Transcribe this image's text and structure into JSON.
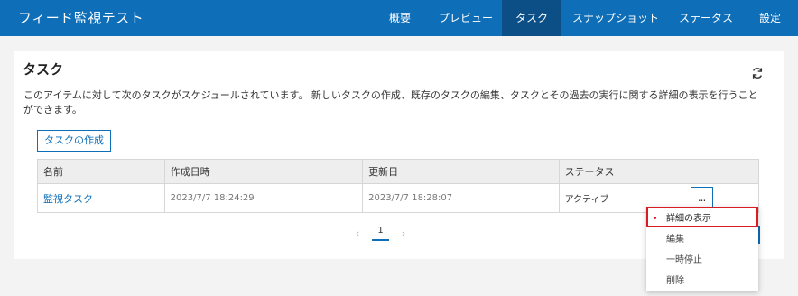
{
  "header": {
    "title": "フィード監視テスト",
    "nav": [
      {
        "label": "概要"
      },
      {
        "label": "プレビュー"
      },
      {
        "label": "タスク"
      },
      {
        "label": "スナップショット"
      },
      {
        "label": "ステータス"
      },
      {
        "label": "設定"
      }
    ],
    "active_nav": "タスク"
  },
  "card": {
    "title": "タスク",
    "refresh_icon": "refresh-icon",
    "description": "このアイテムに対して次のタスクがスケジュールされています。 新しいタスクの作成、既存のタスクの編集、タスクとその過去の実行に関する詳細の表示を行うことができます。",
    "create_button": "タスクの作成"
  },
  "table": {
    "headers": [
      "名前",
      "作成日時",
      "更新日",
      "ステータス"
    ],
    "rows": [
      {
        "name": "監視タスク",
        "created": "2023/7/7 18:24:29",
        "updated": "2023/7/7 18:28:07",
        "status": "アクティブ",
        "more": "..."
      }
    ]
  },
  "pagination": {
    "prev": "‹",
    "current": "1",
    "next": "›"
  },
  "menu": {
    "items": [
      {
        "label": "詳細の表示",
        "selected": true
      },
      {
        "label": "編集"
      },
      {
        "label": "一時停止"
      },
      {
        "label": "削除"
      }
    ]
  },
  "colors": {
    "header_bg": "#0e6eb8",
    "active_tab_bg": "#0b4f86",
    "link": "#0e6eb8",
    "highlight": "#d81c24"
  }
}
